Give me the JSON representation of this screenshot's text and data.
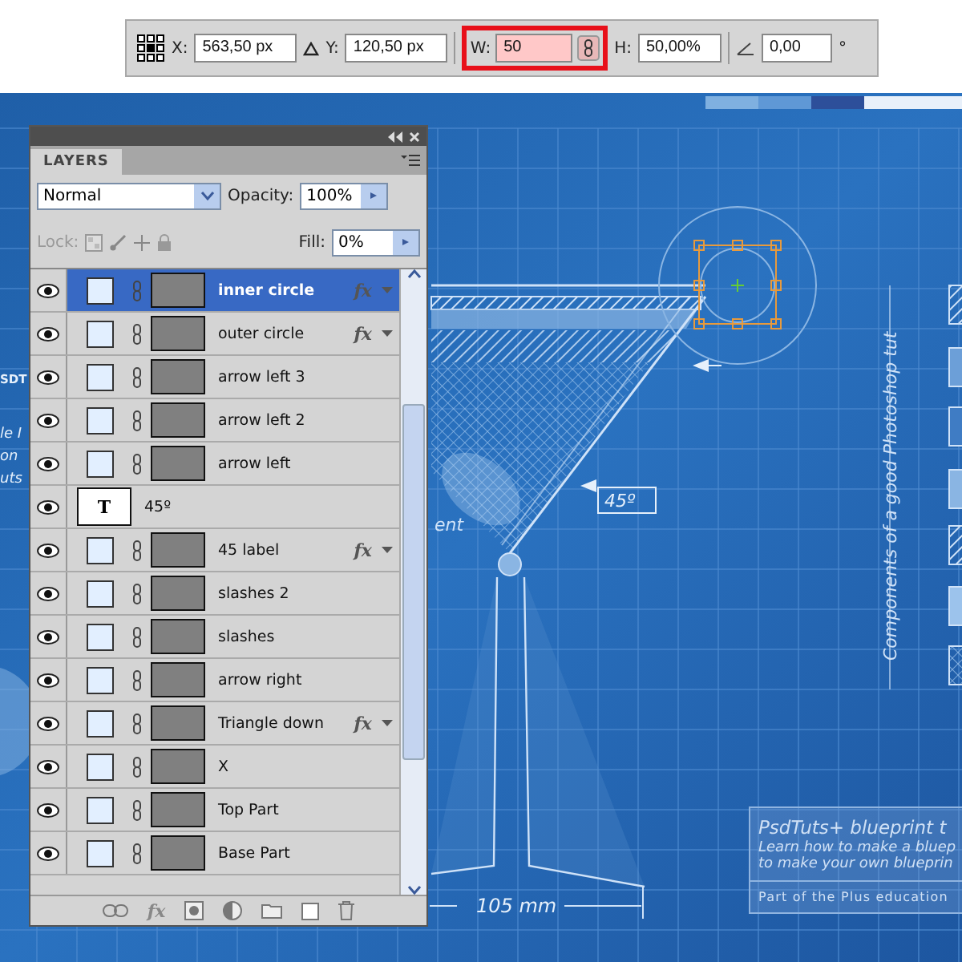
{
  "toolbar": {
    "fields": [
      {
        "label": "X:",
        "value": "563,50 px",
        "highlighted": false
      },
      {
        "label": "Y:",
        "value": "120,50 px",
        "highlighted": false
      },
      {
        "label": "W:",
        "value": "50",
        "highlighted": true
      },
      {
        "label": "H:",
        "value": "50,00%",
        "highlighted": false
      },
      {
        "value": "0,00",
        "highlighted": false
      }
    ],
    "unit": "°"
  },
  "layers_panel": {
    "tab": "LAYERS",
    "blend_mode": "Normal",
    "opacity_label": "Opacity:",
    "opacity": "100%",
    "lock_label": "Lock:",
    "fill_label": "Fill:",
    "fill": "0%",
    "footer_fx": "fx",
    "layers": [
      {
        "name": "inner circle",
        "kind": "shape",
        "selected": true,
        "visible": true,
        "effects": "fx"
      },
      {
        "name": "outer circle",
        "kind": "shape",
        "selected": false,
        "visible": true,
        "effects": "fx"
      },
      {
        "name": "arrow left 3",
        "kind": "shape",
        "selected": false,
        "visible": true
      },
      {
        "name": "arrow left 2",
        "kind": "shape",
        "selected": false,
        "visible": true
      },
      {
        "name": "arrow left",
        "kind": "shape",
        "selected": false,
        "visible": true
      },
      {
        "name": "45º",
        "kind": "text",
        "selected": false,
        "visible": true,
        "thumb_letter": "T"
      },
      {
        "name": "45 label",
        "kind": "shape",
        "selected": false,
        "visible": true,
        "effects": "fx"
      },
      {
        "name": "slashes 2",
        "kind": "shape",
        "selected": false,
        "visible": true
      },
      {
        "name": "slashes",
        "kind": "shape",
        "selected": false,
        "visible": true
      },
      {
        "name": "arrow right",
        "kind": "shape",
        "selected": false,
        "visible": true
      },
      {
        "name": "Triangle down",
        "kind": "shape",
        "selected": false,
        "visible": true,
        "effects": "fx"
      },
      {
        "name": "X",
        "kind": "shape",
        "selected": false,
        "visible": true
      },
      {
        "name": "Top Part",
        "kind": "shape",
        "selected": false,
        "visible": true
      },
      {
        "name": "Base Part",
        "kind": "shape",
        "selected": false,
        "visible": true
      }
    ]
  },
  "canvas": {
    "left_fragments": [
      "SDT",
      "le I",
      "on",
      "uts"
    ],
    "cut_label": "ent",
    "angle_label": "45º",
    "width_label": "105 mm",
    "vertical_caption": "Components of a good Photoshop tut",
    "info_box": {
      "title": "PsdTuts+ blueprint t",
      "lines": [
        "Learn how to make a bluep",
        "to make your own blueprin"
      ],
      "footer": "Part of the Plus education"
    }
  }
}
